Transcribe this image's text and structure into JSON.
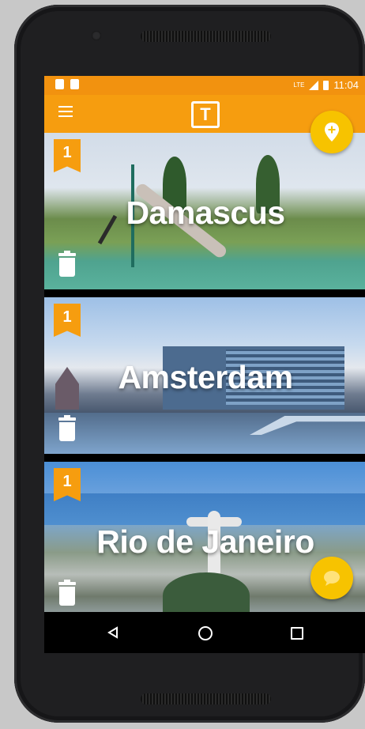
{
  "status_bar": {
    "time": "11:04",
    "network_label": "LTE"
  },
  "app_bar": {
    "logo_letter": "T",
    "menu_icon": "hamburger-menu-icon",
    "fab_icon": "add-location-icon"
  },
  "cities": [
    {
      "name": "Damascus",
      "badge": "1"
    },
    {
      "name": "Amsterdam",
      "badge": "1"
    },
    {
      "name": "Rio de Janeiro",
      "badge": "1"
    }
  ],
  "fab_chat_icon": "chat-bubble-icon",
  "nav": {
    "back_icon": "back-triangle-icon",
    "home_icon": "home-circle-icon",
    "recent_icon": "recent-apps-square-icon"
  },
  "colors": {
    "primary": "#f69d0f",
    "status_bar": "#f2920f",
    "fab": "#f7c300"
  }
}
